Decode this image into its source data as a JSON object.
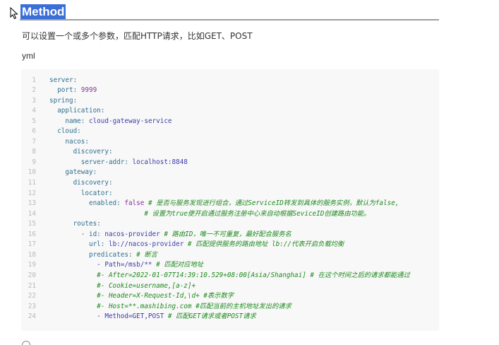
{
  "heading": "Method",
  "description": "可以设置一个或多个参数，匹配HTTP请求，比如GET、POST",
  "code_language": "yml",
  "code_lines": [
    {
      "n": "1",
      "tokens": [
        {
          "t": "server:",
          "c": "k"
        }
      ]
    },
    {
      "n": "2",
      "tokens": [
        {
          "t": "  port: ",
          "c": "k"
        },
        {
          "t": "9999",
          "c": "v"
        }
      ]
    },
    {
      "n": "3",
      "tokens": [
        {
          "t": "spring:",
          "c": "k"
        }
      ]
    },
    {
      "n": "4",
      "tokens": [
        {
          "t": "  application:",
          "c": "k"
        }
      ]
    },
    {
      "n": "5",
      "tokens": [
        {
          "t": "    name: ",
          "c": "k"
        },
        {
          "t": "cloud-gateway-service",
          "c": "s"
        }
      ]
    },
    {
      "n": "6",
      "tokens": [
        {
          "t": "  cloud:",
          "c": "k"
        }
      ]
    },
    {
      "n": "7",
      "tokens": [
        {
          "t": "    nacos:",
          "c": "k"
        }
      ]
    },
    {
      "n": "8",
      "tokens": [
        {
          "t": "      discovery:",
          "c": "k"
        }
      ]
    },
    {
      "n": "9",
      "tokens": [
        {
          "t": "        server-addr: ",
          "c": "k"
        },
        {
          "t": "localhost:8848",
          "c": "s"
        }
      ]
    },
    {
      "n": "10",
      "tokens": [
        {
          "t": "    gateway:",
          "c": "k"
        }
      ]
    },
    {
      "n": "11",
      "tokens": [
        {
          "t": "      discovery:",
          "c": "k"
        }
      ]
    },
    {
      "n": "12",
      "tokens": [
        {
          "t": "        locator:",
          "c": "k"
        }
      ]
    },
    {
      "n": "13",
      "tokens": [
        {
          "t": "          enabled: ",
          "c": "k"
        },
        {
          "t": "false",
          "c": "v"
        },
        {
          "t": " # 是否与服务发现进行组合，通过ServiceID转发到具体的服务实例，默认为false,",
          "c": "c"
        }
      ]
    },
    {
      "n": "14",
      "tokens": [
        {
          "t": "                        # 设置为true便开启通过服务注册中心来自动根据SeviceID创建路由功能。",
          "c": "c"
        }
      ]
    },
    {
      "n": "15",
      "tokens": [
        {
          "t": "      routes:",
          "c": "k"
        }
      ]
    },
    {
      "n": "16",
      "tokens": [
        {
          "t": "        - id: ",
          "c": "k"
        },
        {
          "t": "nacos-provider",
          "c": "s"
        },
        {
          "t": " # 路由ID，唯一不可重复，最好配合服务名",
          "c": "c"
        }
      ]
    },
    {
      "n": "17",
      "tokens": [
        {
          "t": "          url: ",
          "c": "k"
        },
        {
          "t": "lb://nacos-provider",
          "c": "s"
        },
        {
          "t": " # 匹配提供服务的路由地址 lb://代表开启负载均衡",
          "c": "c"
        }
      ]
    },
    {
      "n": "18",
      "tokens": [
        {
          "t": "          predicates: ",
          "c": "k"
        },
        {
          "t": "# 断言",
          "c": "c"
        }
      ]
    },
    {
      "n": "19",
      "tokens": [
        {
          "t": "            - Path=/msb/** ",
          "c": "s"
        },
        {
          "t": "# 匹配对应地址",
          "c": "c"
        }
      ]
    },
    {
      "n": "20",
      "tokens": [
        {
          "t": "            #- After=2022-01-07T14:39:10.529+08:00[Asia/Shanghai] # 在这个时间之后的请求都能通过",
          "c": "c"
        }
      ]
    },
    {
      "n": "21",
      "tokens": [
        {
          "t": "            #- Cookie=username,[a-z]+",
          "c": "c"
        }
      ]
    },
    {
      "n": "22",
      "tokens": [
        {
          "t": "            #- Header=X-Request-Id,\\d+ #表示数字",
          "c": "c"
        }
      ]
    },
    {
      "n": "23",
      "tokens": [
        {
          "t": "            #- Host=**.mashibing.com #匹配当前的主机地址发出的请求",
          "c": "c"
        }
      ]
    },
    {
      "n": "24",
      "tokens": [
        {
          "t": "            - Method=GET,POST ",
          "c": "s"
        },
        {
          "t": "# 匹配GET请求或者POST请求",
          "c": "c"
        }
      ]
    }
  ]
}
